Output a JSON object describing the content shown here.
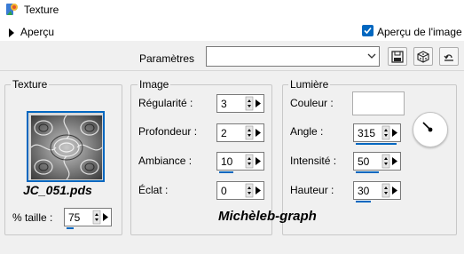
{
  "window": {
    "title": "Texture",
    "app_icon": "paint-program-icon"
  },
  "preview": {
    "toggle_label": "Aperçu",
    "checkbox_label": "Aperçu de l'image",
    "checkbox_checked": true
  },
  "params": {
    "label": "Paramètres",
    "value": "",
    "buttons": [
      "save-preset-icon",
      "randomize-icon",
      "reset-icon"
    ]
  },
  "texture": {
    "legend": "Texture",
    "name": "JC_051.pds",
    "size_label": "% taille :",
    "size_value": "75"
  },
  "image": {
    "legend": "Image",
    "fields": [
      {
        "label": "Régularité :",
        "value": "3"
      },
      {
        "label": "Profondeur :",
        "value": "2"
      },
      {
        "label": "Ambiance :",
        "value": "10"
      },
      {
        "label": "Éclat :",
        "value": "0"
      }
    ]
  },
  "light": {
    "legend": "Lumière",
    "color_label": "Couleur :",
    "color_value": "#ffffff",
    "fields": [
      {
        "label": "Angle :",
        "value": "315"
      },
      {
        "label": "Intensité :",
        "value": "50"
      },
      {
        "label": "Hauteur :",
        "value": "30"
      }
    ],
    "angle": 315
  },
  "watermark": "Michèleb-graph",
  "colors": {
    "accent": "#0067c0",
    "border": "#7a7a7a",
    "window_bg": "#f0f0f0"
  }
}
